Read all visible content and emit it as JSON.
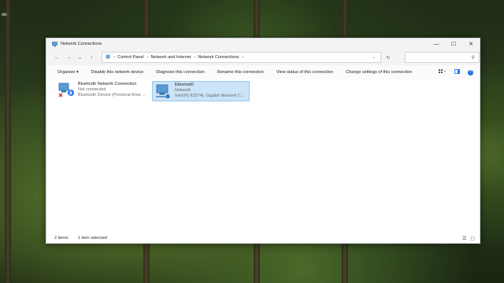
{
  "desktop": {
    "label": "din"
  },
  "window": {
    "title": "Network Connections",
    "controls": {
      "minimize": "—",
      "maximize": "☐",
      "close": "✕"
    }
  },
  "nav": {
    "back": "←",
    "forward": "→",
    "recent": "⌄",
    "up": "↑",
    "refresh": "↻",
    "dropdown": "⌄",
    "breadcrumb": [
      "Control Panel",
      "Network and Internet",
      "Network Connections"
    ],
    "search_placeholder": ""
  },
  "commands": [
    "Organize",
    "Disable this network device",
    "Diagnose this connection",
    "Rename this connection",
    "View status of this connection",
    "Change settings of this connection"
  ],
  "organize_arrow": "▾",
  "connections": [
    {
      "name": "Bluetooth Network Connection",
      "status": "Not connected",
      "device": "Bluetooth Device (Personal Area ..."
    },
    {
      "name": "Ethernet0",
      "status": "Network",
      "device": "Intel(R) 82574L Gigabit Network C..."
    }
  ],
  "status": {
    "item_count": "2 items",
    "selected": "1 item selected"
  },
  "colors": {
    "selection": "#cce4f7",
    "accent": "#1a73e8"
  }
}
